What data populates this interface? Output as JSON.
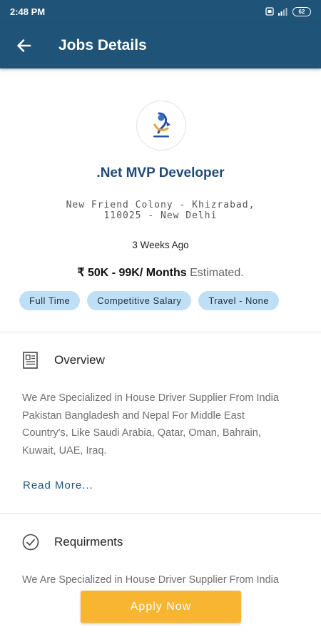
{
  "status_bar": {
    "time": "2:48 PM",
    "battery": "62"
  },
  "app_bar": {
    "title": "Jobs Details"
  },
  "job": {
    "title": ".Net MVP Developer",
    "address_line1": "New Friend Colony - Khizrabad,",
    "address_line2": "110025 - New Delhi",
    "posted": "3 Weeks Ago",
    "salary": "₹ 50K - 99K/ Months",
    "salary_note": "Estimated.",
    "tags": [
      "Full Time",
      "Competitive Salary",
      "Travel - None"
    ]
  },
  "overview": {
    "heading": "Overview",
    "lines": [
      "We Are Specialized in House Driver Supplier From India",
      "Pakistan Bangladesh and Nepal For Middle East",
      "Country's, Like Saudi Arabia, Qatar, Oman, Bahrain,",
      "Kuwait, UAE, Iraq."
    ],
    "read_more": "Read More..."
  },
  "requirements": {
    "heading": "Requirments",
    "lines": [
      "We Are Specialized in House Driver Supplier From India"
    ]
  },
  "apply_button": "Apply Now",
  "colors": {
    "primary": "#1f5478",
    "accent": "#f7b531",
    "tag_bg": "#bedff5"
  },
  "icons": {
    "back": "arrow-left-icon",
    "overview": "document-icon",
    "requirements": "check-circle-icon"
  }
}
